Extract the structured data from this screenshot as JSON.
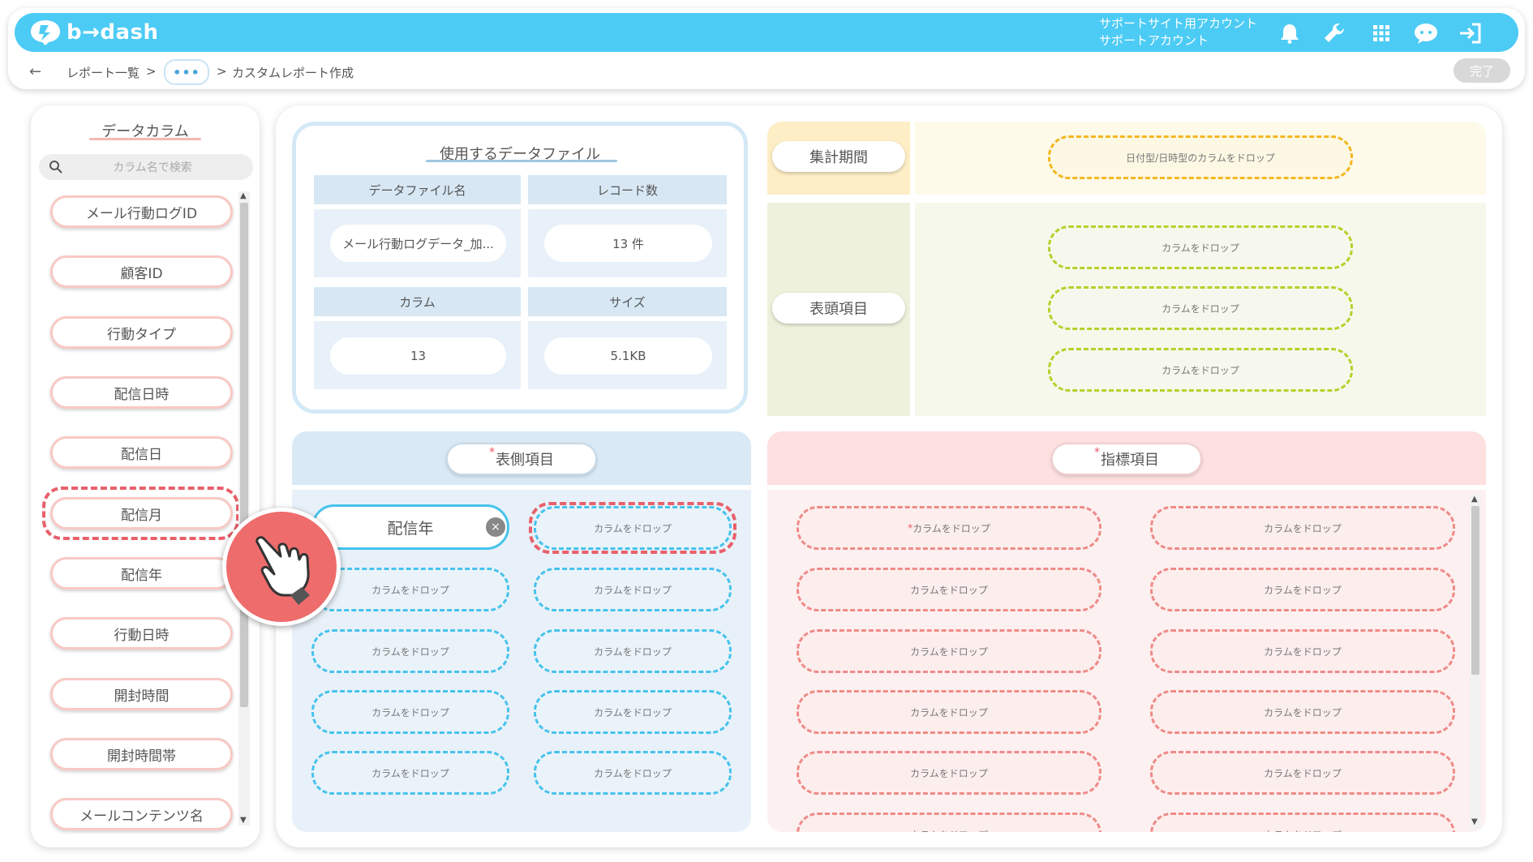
{
  "app": {
    "logo_text": "b→dash",
    "account_line1": "サポートサイト用アカウント",
    "account_line2": "サポートアカウント"
  },
  "header": {
    "icons": [
      "bell-icon",
      "wrench-icon",
      "grid-icon",
      "chat-bot-icon",
      "logout-icon"
    ],
    "breadcrumb": {
      "back": "←",
      "item1": "レポート一覧",
      "sep1": ">",
      "more": "•••",
      "sep2": ">",
      "item2": "カスタムレポート作成"
    },
    "done_label": "完了"
  },
  "sidebar": {
    "title": "データカラム",
    "search_placeholder": "カラム名で検索",
    "columns": [
      "メール行動ログID",
      "顧客ID",
      "行動タイプ",
      "配信日時",
      "配信日",
      "配信月",
      "配信年",
      "行動日時",
      "開封時間",
      "開封時間帯",
      "メールコンテンツ名"
    ],
    "scroll_up": "▲",
    "scroll_down": "▼"
  },
  "data_file": {
    "title": "使用するデータファイル",
    "name_header": "データファイル名",
    "name_value": "メール行動ログデータ_加...",
    "records_header": "レコード数",
    "records_value": "13 件",
    "columns_header": "カラム",
    "columns_value": "13",
    "size_header": "サイズ",
    "size_value": "5.1KB"
  },
  "period": {
    "label": "集計期間",
    "drop_text": "日付型/日時型のカラムをドロップ"
  },
  "header_items": {
    "label": "表頭項目",
    "drops": [
      "カラムをドロップ",
      "カラムをドロップ",
      "カラムをドロップ"
    ]
  },
  "row_items": {
    "required_mark": "*",
    "label": "表側項目",
    "filled_value": "配信年",
    "remove_icon": "×",
    "drop_text": "カラムをドロップ"
  },
  "metrics": {
    "required_mark": "*",
    "label": "指標項目",
    "first_drop_mark": "*",
    "drop_text": "カラムをドロップ"
  },
  "colors": {
    "brand": "#4ccbf5",
    "highlight": "#e8606b",
    "row_drop": "#46c3ec",
    "metric_drop": "#ee8b88",
    "header_drop": "#b9cf2a",
    "period_drop": "#f3b81f"
  }
}
